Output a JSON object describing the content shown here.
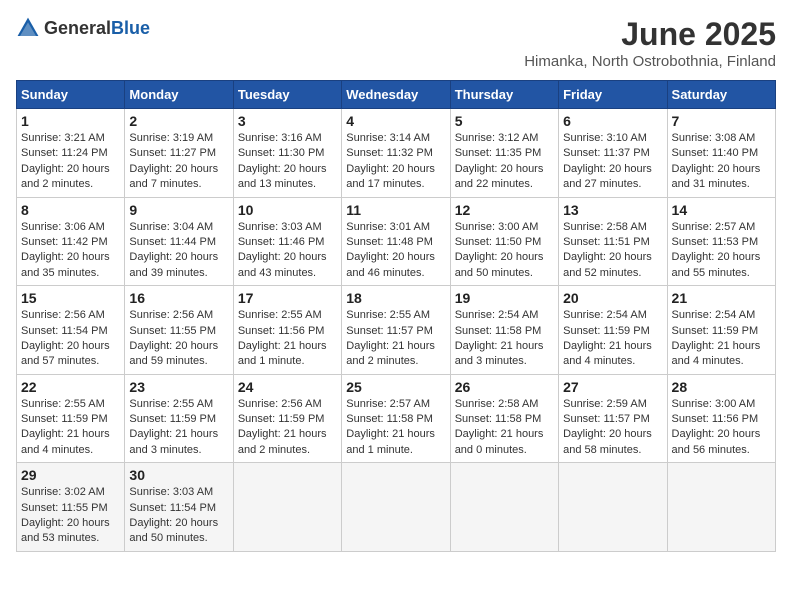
{
  "header": {
    "logo_general": "General",
    "logo_blue": "Blue",
    "month_title": "June 2025",
    "location": "Himanka, North Ostrobothnia, Finland"
  },
  "weekdays": [
    "Sunday",
    "Monday",
    "Tuesday",
    "Wednesday",
    "Thursday",
    "Friday",
    "Saturday"
  ],
  "weeks": [
    [
      {
        "day": "1",
        "sunrise": "3:21 AM",
        "sunset": "11:24 PM",
        "daylight": "20 hours and 2 minutes."
      },
      {
        "day": "2",
        "sunrise": "3:19 AM",
        "sunset": "11:27 PM",
        "daylight": "20 hours and 7 minutes."
      },
      {
        "day": "3",
        "sunrise": "3:16 AM",
        "sunset": "11:30 PM",
        "daylight": "20 hours and 13 minutes."
      },
      {
        "day": "4",
        "sunrise": "3:14 AM",
        "sunset": "11:32 PM",
        "daylight": "20 hours and 17 minutes."
      },
      {
        "day": "5",
        "sunrise": "3:12 AM",
        "sunset": "11:35 PM",
        "daylight": "20 hours and 22 minutes."
      },
      {
        "day": "6",
        "sunrise": "3:10 AM",
        "sunset": "11:37 PM",
        "daylight": "20 hours and 27 minutes."
      },
      {
        "day": "7",
        "sunrise": "3:08 AM",
        "sunset": "11:40 PM",
        "daylight": "20 hours and 31 minutes."
      }
    ],
    [
      {
        "day": "8",
        "sunrise": "3:06 AM",
        "sunset": "11:42 PM",
        "daylight": "20 hours and 35 minutes."
      },
      {
        "day": "9",
        "sunrise": "3:04 AM",
        "sunset": "11:44 PM",
        "daylight": "20 hours and 39 minutes."
      },
      {
        "day": "10",
        "sunrise": "3:03 AM",
        "sunset": "11:46 PM",
        "daylight": "20 hours and 43 minutes."
      },
      {
        "day": "11",
        "sunrise": "3:01 AM",
        "sunset": "11:48 PM",
        "daylight": "20 hours and 46 minutes."
      },
      {
        "day": "12",
        "sunrise": "3:00 AM",
        "sunset": "11:50 PM",
        "daylight": "20 hours and 50 minutes."
      },
      {
        "day": "13",
        "sunrise": "2:58 AM",
        "sunset": "11:51 PM",
        "daylight": "20 hours and 52 minutes."
      },
      {
        "day": "14",
        "sunrise": "2:57 AM",
        "sunset": "11:53 PM",
        "daylight": "20 hours and 55 minutes."
      }
    ],
    [
      {
        "day": "15",
        "sunrise": "2:56 AM",
        "sunset": "11:54 PM",
        "daylight": "20 hours and 57 minutes."
      },
      {
        "day": "16",
        "sunrise": "2:56 AM",
        "sunset": "11:55 PM",
        "daylight": "20 hours and 59 minutes."
      },
      {
        "day": "17",
        "sunrise": "2:55 AM",
        "sunset": "11:56 PM",
        "daylight": "21 hours and 1 minute."
      },
      {
        "day": "18",
        "sunrise": "2:55 AM",
        "sunset": "11:57 PM",
        "daylight": "21 hours and 2 minutes."
      },
      {
        "day": "19",
        "sunrise": "2:54 AM",
        "sunset": "11:58 PM",
        "daylight": "21 hours and 3 minutes."
      },
      {
        "day": "20",
        "sunrise": "2:54 AM",
        "sunset": "11:59 PM",
        "daylight": "21 hours and 4 minutes."
      },
      {
        "day": "21",
        "sunrise": "2:54 AM",
        "sunset": "11:59 PM",
        "daylight": "21 hours and 4 minutes."
      }
    ],
    [
      {
        "day": "22",
        "sunrise": "2:55 AM",
        "sunset": "11:59 PM",
        "daylight": "21 hours and 4 minutes."
      },
      {
        "day": "23",
        "sunrise": "2:55 AM",
        "sunset": "11:59 PM",
        "daylight": "21 hours and 3 minutes."
      },
      {
        "day": "24",
        "sunrise": "2:56 AM",
        "sunset": "11:59 PM",
        "daylight": "21 hours and 2 minutes."
      },
      {
        "day": "25",
        "sunrise": "2:57 AM",
        "sunset": "11:58 PM",
        "daylight": "21 hours and 1 minute."
      },
      {
        "day": "26",
        "sunrise": "2:58 AM",
        "sunset": "11:58 PM",
        "daylight": "21 hours and 0 minutes."
      },
      {
        "day": "27",
        "sunrise": "2:59 AM",
        "sunset": "11:57 PM",
        "daylight": "20 hours and 58 minutes."
      },
      {
        "day": "28",
        "sunrise": "3:00 AM",
        "sunset": "11:56 PM",
        "daylight": "20 hours and 56 minutes."
      }
    ],
    [
      {
        "day": "29",
        "sunrise": "3:02 AM",
        "sunset": "11:55 PM",
        "daylight": "20 hours and 53 minutes."
      },
      {
        "day": "30",
        "sunrise": "3:03 AM",
        "sunset": "11:54 PM",
        "daylight": "20 hours and 50 minutes."
      },
      null,
      null,
      null,
      null,
      null
    ]
  ]
}
